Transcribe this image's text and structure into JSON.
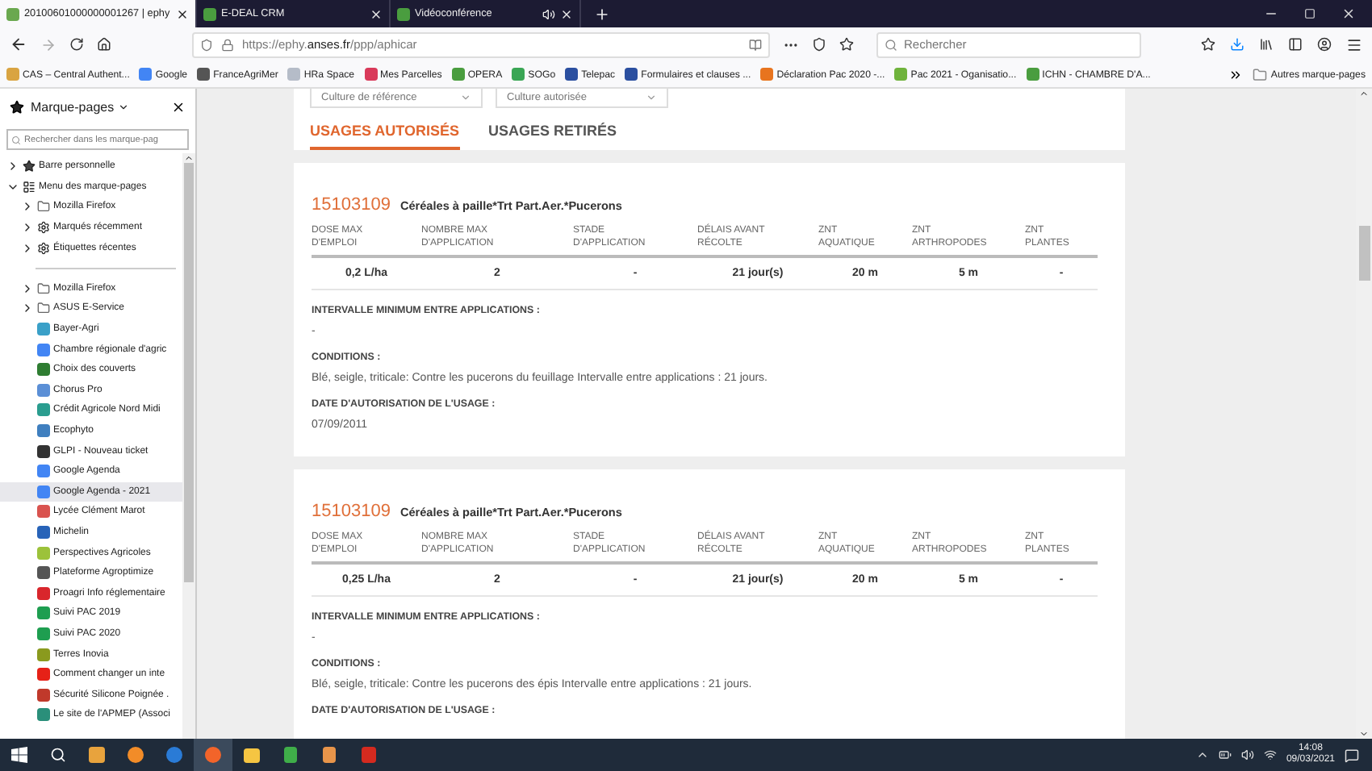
{
  "browser_tabs": [
    {
      "title": "20100601000000001267 | ephy",
      "selected": true,
      "playing_audio": false
    },
    {
      "title": "E-DEAL CRM",
      "selected": false,
      "playing_audio": false
    },
    {
      "title": "Vidéoconférence",
      "selected": false,
      "playing_audio": true
    }
  ],
  "address_bar": {
    "url": "https://ephy.**anses.fr**/ppp/aphicar"
  },
  "search_field": {
    "placeholder": "Rechercher"
  },
  "bookmarks_bar": {
    "items": [
      {
        "label": "CAS – Central Authent...",
        "color": "#d9a441"
      },
      {
        "label": "Google",
        "color": "#4285f4"
      },
      {
        "label": "FranceAgriMer",
        "color": "#555555"
      },
      {
        "label": "HRa Space",
        "color": "#b5bcc8"
      },
      {
        "label": "Mes Parcelles",
        "color": "#d93a5a"
      },
      {
        "label": "OPERA",
        "color": "#4a9d3f"
      },
      {
        "label": "SOGo",
        "color": "#3aa655"
      },
      {
        "label": "Telepac",
        "color": "#2b4fa0"
      },
      {
        "label": "Formulaires et clauses ...",
        "color": "#2b4fa0"
      },
      {
        "label": "Déclaration Pac 2020 -...",
        "color": "#e8741e"
      },
      {
        "label": "Pac 2021 - Oganisatio...",
        "color": "#6fb33c"
      },
      {
        "label": "ICHN - CHAMBRE D'A...",
        "color": "#4a9d3f"
      }
    ],
    "other": "Autres marque-pages"
  },
  "sidebar": {
    "title": "Marque-pages",
    "search": {
      "placeholder": "Rechercher dans les marque-pag"
    },
    "tree": [
      {
        "kind": "toolbar",
        "label": "Barre personnelle",
        "expanded": false,
        "selected": false
      },
      {
        "kind": "menu",
        "label": "Menu des marque-pages",
        "expanded": true,
        "selected": false,
        "children": [
          {
            "kind": "folder",
            "label": "Mozilla Firefox",
            "expanded": false,
            "selected": false
          },
          {
            "kind": "tag",
            "label": "Marqués récemment",
            "expanded": false,
            "selected": false
          },
          {
            "kind": "tag",
            "label": "Étiquettes récentes",
            "expanded": false,
            "selected": false
          },
          {
            "kind": "separator"
          },
          {
            "kind": "folder",
            "label": "Mozilla Firefox",
            "expanded": false,
            "selected": false
          },
          {
            "kind": "folder",
            "label": "ASUS E-Service",
            "expanded": false,
            "selected": false
          },
          {
            "kind": "bookmark",
            "label": "Bayer-Agri",
            "selected": false,
            "color": "#3aa0c8"
          },
          {
            "kind": "bookmark",
            "label": "Chambre régionale d'agric",
            "selected": false,
            "color": "#4285f4"
          },
          {
            "kind": "bookmark",
            "label": "Choix des couverts",
            "selected": false,
            "color": "#2f7d32"
          },
          {
            "kind": "bookmark",
            "label": "Chorus Pro",
            "selected": false,
            "color": "#5b8fd6"
          },
          {
            "kind": "bookmark",
            "label": "Crédit Agricole Nord Midi",
            "selected": false,
            "color": "#2a9d8f"
          },
          {
            "kind": "bookmark",
            "label": "Ecophyto",
            "selected": false,
            "color": "#3f7fbf"
          },
          {
            "kind": "bookmark",
            "label": "GLPI - Nouveau ticket",
            "selected": false,
            "color": "#333333"
          },
          {
            "kind": "bookmark",
            "label": "Google Agenda",
            "selected": false,
            "color": "#4285f4"
          },
          {
            "kind": "bookmark",
            "label": "Google Agenda - 2021",
            "selected": true,
            "color": "#4285f4"
          },
          {
            "kind": "bookmark",
            "label": "Lycée Clément Marot",
            "selected": false,
            "color": "#d9534f"
          },
          {
            "kind": "bookmark",
            "label": "Michelin",
            "selected": false,
            "color": "#2763b8"
          },
          {
            "kind": "bookmark",
            "label": "Perspectives Agricoles",
            "selected": false,
            "color": "#9cc23a"
          },
          {
            "kind": "bookmark",
            "label": "Plateforme Agroptimize",
            "selected": false,
            "color": "#555555"
          },
          {
            "kind": "bookmark",
            "label": "Proagri Info réglementaire",
            "selected": false,
            "color": "#d9262c"
          },
          {
            "kind": "bookmark",
            "label": "Suivi PAC 2019",
            "selected": false,
            "color": "#1e9e50"
          },
          {
            "kind": "bookmark",
            "label": "Suivi PAC 2020",
            "selected": false,
            "color": "#1e9e50"
          },
          {
            "kind": "bookmark",
            "label": "Terres Inovia",
            "selected": false,
            "color": "#8a9a1e"
          },
          {
            "kind": "bookmark",
            "label": "Comment changer un inte",
            "selected": false,
            "color": "#e62117"
          },
          {
            "kind": "bookmark",
            "label": "Sécurité Silicone Poignée .",
            "selected": false,
            "color": "#c0392b"
          },
          {
            "kind": "bookmark",
            "label": "Le site de l'APMEP (Associ",
            "selected": false,
            "color": "#2a8f7a"
          }
        ]
      }
    ]
  },
  "page": {
    "filters": [
      {
        "placeholder": "Culture de référence"
      },
      {
        "placeholder": "Culture autorisée"
      }
    ],
    "tabs": [
      {
        "label": "USAGES AUTORISÉS",
        "selected": true
      },
      {
        "label": "USAGES RETIRÉS",
        "selected": false
      }
    ],
    "usages": [
      {
        "code": "15103109",
        "title": "Céréales à paille*Trt Part.Aer.*Pucerons",
        "columns": [
          "DOSE MAX\nD'EMPLOI",
          "NOMBRE MAX\nD'APPLICATION",
          "STADE\nD'APPLICATION",
          "DÉLAIS AVANT\nRÉCOLTE",
          "ZNT\nAQUATIQUE",
          "ZNT\nARTHROPODES",
          "ZNT\nPLANTES"
        ],
        "values": [
          "0,2 L/ha",
          "2",
          "-",
          "21 jour(s)",
          "20 m",
          "5 m",
          "-"
        ],
        "interval_label": "INTERVALLE MINIMUM ENTRE APPLICATIONS :",
        "interval": "-",
        "conditions_label": "CONDITIONS :",
        "conditions": "Blé, seigle, triticale: Contre les pucerons du feuillage Intervalle entre applications : 21 jours.",
        "date_label": "DATE D'AUTORISATION DE L'USAGE :",
        "date": "07/09/2011"
      },
      {
        "code": "15103109",
        "title": "Céréales à paille*Trt Part.Aer.*Pucerons",
        "columns": [
          "DOSE MAX\nD'EMPLOI",
          "NOMBRE MAX\nD'APPLICATION",
          "STADE\nD'APPLICATION",
          "DÉLAIS AVANT\nRÉCOLTE",
          "ZNT\nAQUATIQUE",
          "ZNT\nARTHROPODES",
          "ZNT\nPLANTES"
        ],
        "values": [
          "0,25 L/ha",
          "2",
          "-",
          "21 jour(s)",
          "20 m",
          "5 m",
          "-"
        ],
        "interval_label": "INTERVALLE MINIMUM ENTRE APPLICATIONS :",
        "interval": "-",
        "conditions_label": "CONDITIONS :",
        "conditions": "Blé, seigle, triticale: Contre les pucerons des épis Intervalle entre applications : 21 jours.",
        "date_label": "DATE D'AUTORISATION DE L'USAGE :"
      }
    ]
  },
  "taskbar": {
    "time": "14:08",
    "date": "09/03/2021"
  }
}
